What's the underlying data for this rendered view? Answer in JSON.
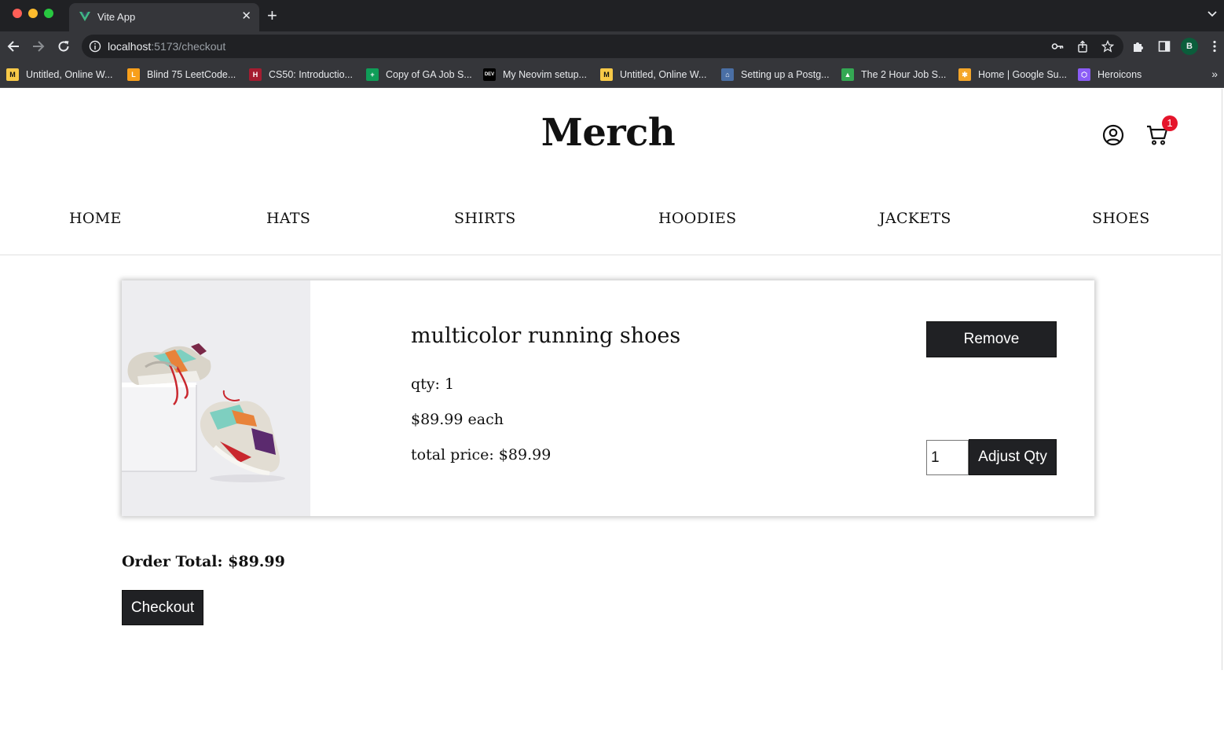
{
  "browser": {
    "tab_title": "Vite App",
    "url_host": "localhost",
    "url_rest": ":5173/checkout",
    "profile_initial": "B",
    "bookmarks": [
      {
        "label": "Untitled, Online W...",
        "icon": "miro-icon",
        "color": "#f7c948"
      },
      {
        "label": "Blind 75 LeetCode...",
        "icon": "leetcode-icon",
        "color": "#f89f1b"
      },
      {
        "label": "CS50: Introductio...",
        "icon": "harvard-icon",
        "color": "#a51c30"
      },
      {
        "label": "Copy of GA Job S...",
        "icon": "sheets-icon",
        "color": "#0f9d58"
      },
      {
        "label": "My Neovim setup...",
        "icon": "dev-icon",
        "color": "#000000"
      },
      {
        "label": "Untitled, Online W...",
        "icon": "miro-icon",
        "color": "#f7c948"
      },
      {
        "label": "Setting up a Postg...",
        "icon": "house-icon",
        "color": "#4a6fa5"
      },
      {
        "label": "The 2 Hour Job S...",
        "icon": "drive-icon",
        "color": "#34a853"
      },
      {
        "label": "Home | Google Su...",
        "icon": "google-suite-icon",
        "color": "#f4a62a"
      },
      {
        "label": "Heroicons",
        "icon": "heroicons-icon",
        "color": "#8b5cf6"
      }
    ]
  },
  "header": {
    "brand": "Merch",
    "cart_count": "1"
  },
  "nav": {
    "items": [
      "HOME",
      "HATS",
      "SHIRTS",
      "HOODIES",
      "JACKETS",
      "SHOES"
    ]
  },
  "cart_item": {
    "title": "multicolor running shoes",
    "qty_text": "qty: 1",
    "each_text": "$89.99 each",
    "total_text": "total price: $89.99",
    "remove_label": "Remove",
    "qty_value": "1",
    "adjust_label": "Adjust Qty"
  },
  "order": {
    "total_text": "Order Total: $89.99",
    "checkout_label": "Checkout"
  },
  "colors": {
    "button_bg": "#202124",
    "badge": "#e5142b"
  }
}
